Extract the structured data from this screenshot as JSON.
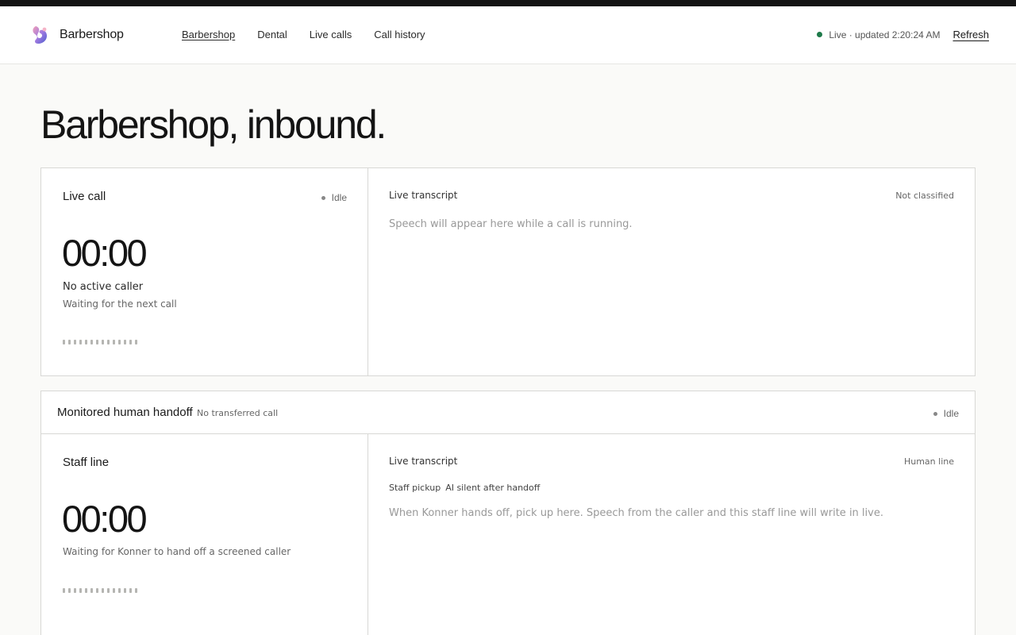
{
  "header": {
    "brand": "Barbershop",
    "nav": [
      {
        "label": "Barbershop",
        "active": true
      },
      {
        "label": "Dental",
        "active": false
      },
      {
        "label": "Live calls",
        "active": false
      },
      {
        "label": "Call history",
        "active": false
      }
    ],
    "status_text": "Live · updated 2:20:24 AM",
    "status_color": "#1e7a4a",
    "refresh_label": "Refresh"
  },
  "page": {
    "title": "Barbershop, inbound."
  },
  "live_call": {
    "title": "Live call",
    "status": "Idle",
    "timer": "00:00",
    "caller": "No active caller",
    "subtext": "Waiting for the next call"
  },
  "live_transcript": {
    "title": "Live transcript",
    "classification": "Not classified",
    "placeholder": "Speech will appear here while a call is running."
  },
  "handoff": {
    "title": "Monitored human handoff",
    "subtitle": "No transferred call",
    "status": "Idle",
    "staff_line": {
      "title": "Staff line",
      "timer": "00:00",
      "subtext": "Waiting for Konner to hand off a screened caller"
    },
    "transcript": {
      "title": "Live transcript",
      "line_label": "Human line",
      "tags": [
        "Staff pickup",
        "AI silent after handoff"
      ],
      "placeholder": "When Konner hands off, pick up here. Speech from the caller and this staff line will write in live."
    }
  }
}
